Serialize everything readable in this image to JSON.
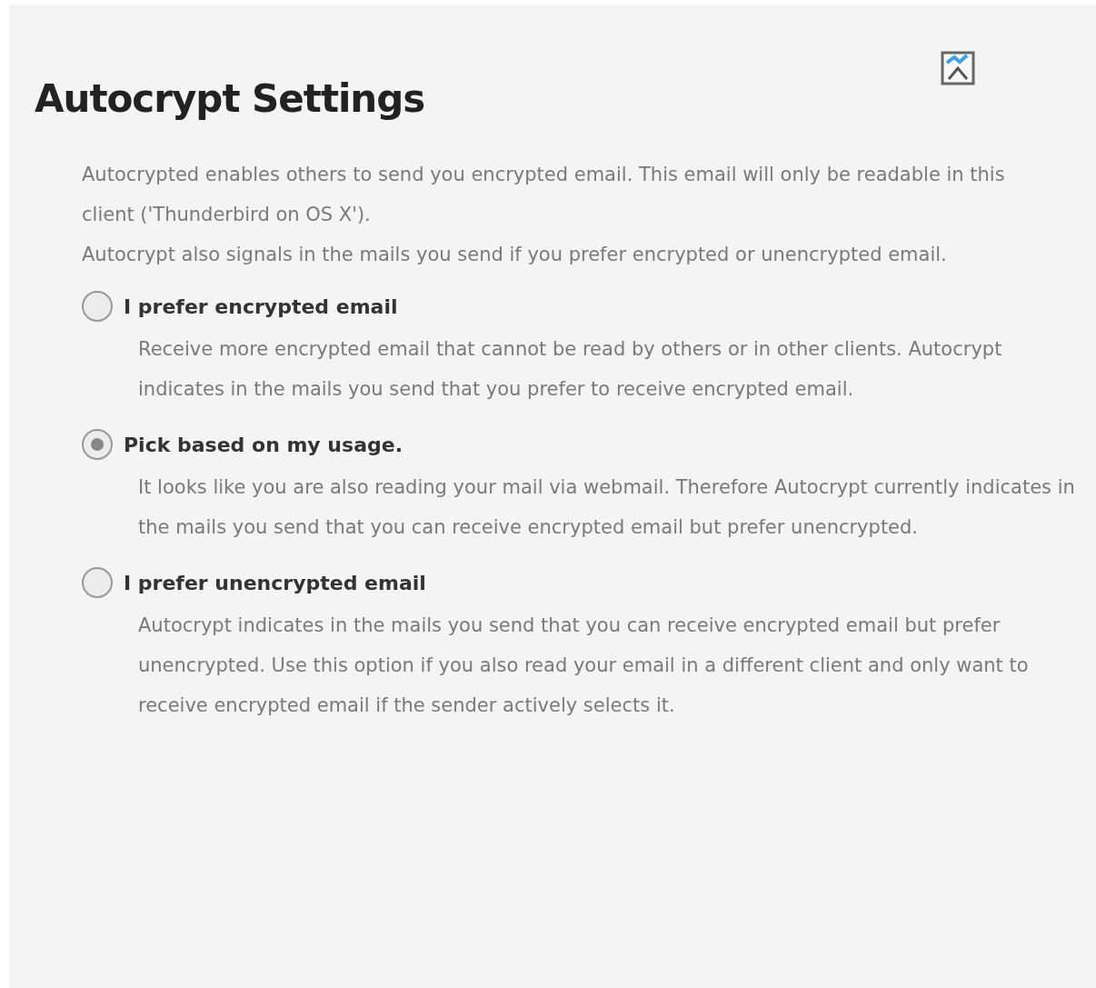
{
  "title": "Autocrypt Settings",
  "intro": [
    "Autocrypted enables others to send you encrypted email. This email will only be readable in this client ('Thunderbird on OS X').",
    "Autocrypt also signals in the mails you send if you prefer encrypted or unencrypted email."
  ],
  "options": [
    {
      "label": "I prefer encrypted email",
      "selected": false,
      "description": "Receive more encrypted email that cannot be read by others or in other clients. Autocrypt indicates in the mails you send that you prefer to receive encrypted email."
    },
    {
      "label": "Pick based on my usage.",
      "selected": true,
      "description": "It looks like you are also reading your mail via webmail. Therefore Autocrypt currently indicates in the mails you send that you can receive encrypted email but prefer unencrypted."
    },
    {
      "label": "I prefer unencrypted email",
      "selected": false,
      "description": "Autocrypt indicates in the mails you send that you can receive encrypted email but prefer unencrypted. Use this option if you also read your email in a different client and only want to receive encrypted email if the sender actively selects it."
    }
  ]
}
